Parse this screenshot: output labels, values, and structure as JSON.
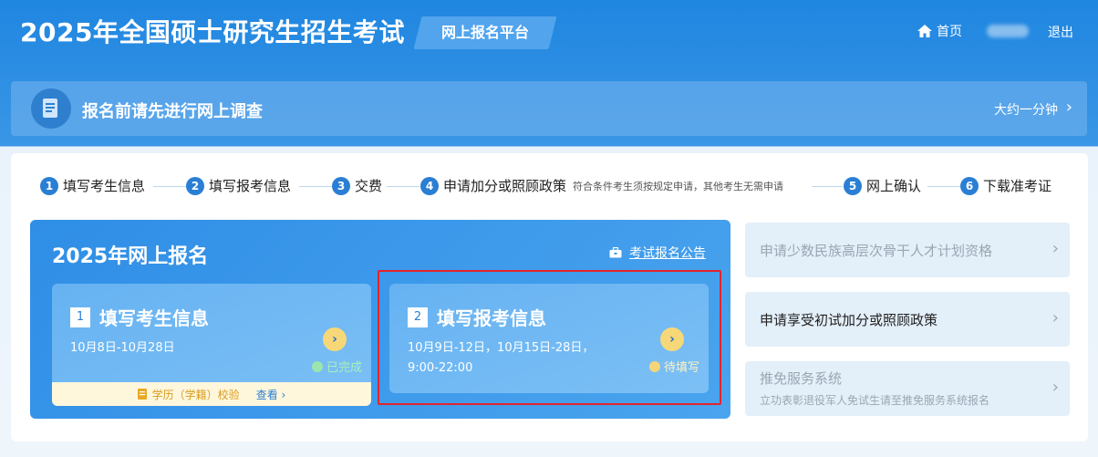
{
  "header": {
    "title": "2025年全国硕士研究生招生考试",
    "platform": "网上报名平台",
    "home_label": "首页",
    "logout_label": "退出"
  },
  "survey": {
    "text": "报名前请先进行网上调查",
    "time": "大约一分钟",
    "arrow": "›"
  },
  "steps": [
    {
      "num": "1",
      "label": "填写考生信息"
    },
    {
      "num": "2",
      "label": "填写报考信息"
    },
    {
      "num": "3",
      "label": "交费"
    },
    {
      "num": "4",
      "label": "申请加分或照顾政策",
      "note": "符合条件考生须按规定申请，其他考生无需申请"
    },
    {
      "num": "5",
      "label": "网上确认"
    },
    {
      "num": "6",
      "label": "下载准考证"
    }
  ],
  "apply": {
    "title": "2025年网上报名",
    "announcement": "考试报名公告",
    "cards": [
      {
        "num": "1",
        "title": "填写考生信息",
        "date": "10月8日-10月28日",
        "status": "已完成",
        "verify_label": "学历（学籍）校验",
        "view_label": "查看 ›"
      },
      {
        "num": "2",
        "title": "填写报考信息",
        "date_line1": "10月9日-12日，10月15日-28日，",
        "date_line2": "9:00-22:00",
        "status": "待填写"
      }
    ]
  },
  "options": [
    {
      "label": "申请少数民族高层次骨干人才计划资格"
    },
    {
      "label": "申请享受初试加分或照顾政策"
    },
    {
      "label": "推免服务系统",
      "sub": "立功表彰退役军人免试生请至推免服务系统报名"
    }
  ],
  "colors": {
    "primary": "#2a7fd4",
    "highlight": "#e3242b",
    "button_yellow": "#f7d878"
  }
}
